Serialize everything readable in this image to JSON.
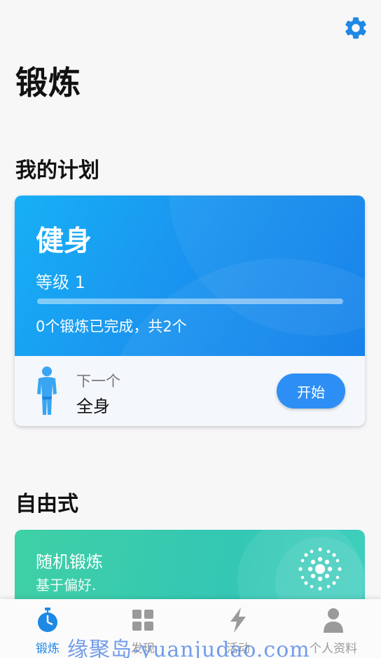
{
  "header": {
    "title": "锻炼",
    "settings_icon": "gear-icon"
  },
  "my_plan": {
    "section_title": "我的计划",
    "card": {
      "name": "健身",
      "level": "等级 1",
      "progress_fraction": 0,
      "completed_text": "0个锻炼已完成，共2个",
      "next_label": "下一个",
      "next_workout": "全身",
      "start_label": "开始",
      "figure_icon": "person-figure-icon"
    }
  },
  "freestyle": {
    "section_title": "自由式",
    "card": {
      "title": "随机锻炼",
      "subtitle": "基于偏好.",
      "icon": "random-dots-icon"
    }
  },
  "bottom_nav": {
    "items": [
      {
        "label": "锻炼",
        "icon": "stopwatch-icon",
        "active": true
      },
      {
        "label": "发现",
        "icon": "grid-icon",
        "active": false
      },
      {
        "label": "活动",
        "icon": "lightning-icon",
        "active": false
      },
      {
        "label": "个人资料",
        "icon": "person-icon",
        "active": false
      }
    ]
  },
  "watermark": "缘聚岛-yuanjudao.com",
  "colors": {
    "accent": "#1e88e5",
    "plan_card": "#1a95f0",
    "free_card": "#3fd0a6",
    "start_button": "#2d8ff5"
  }
}
